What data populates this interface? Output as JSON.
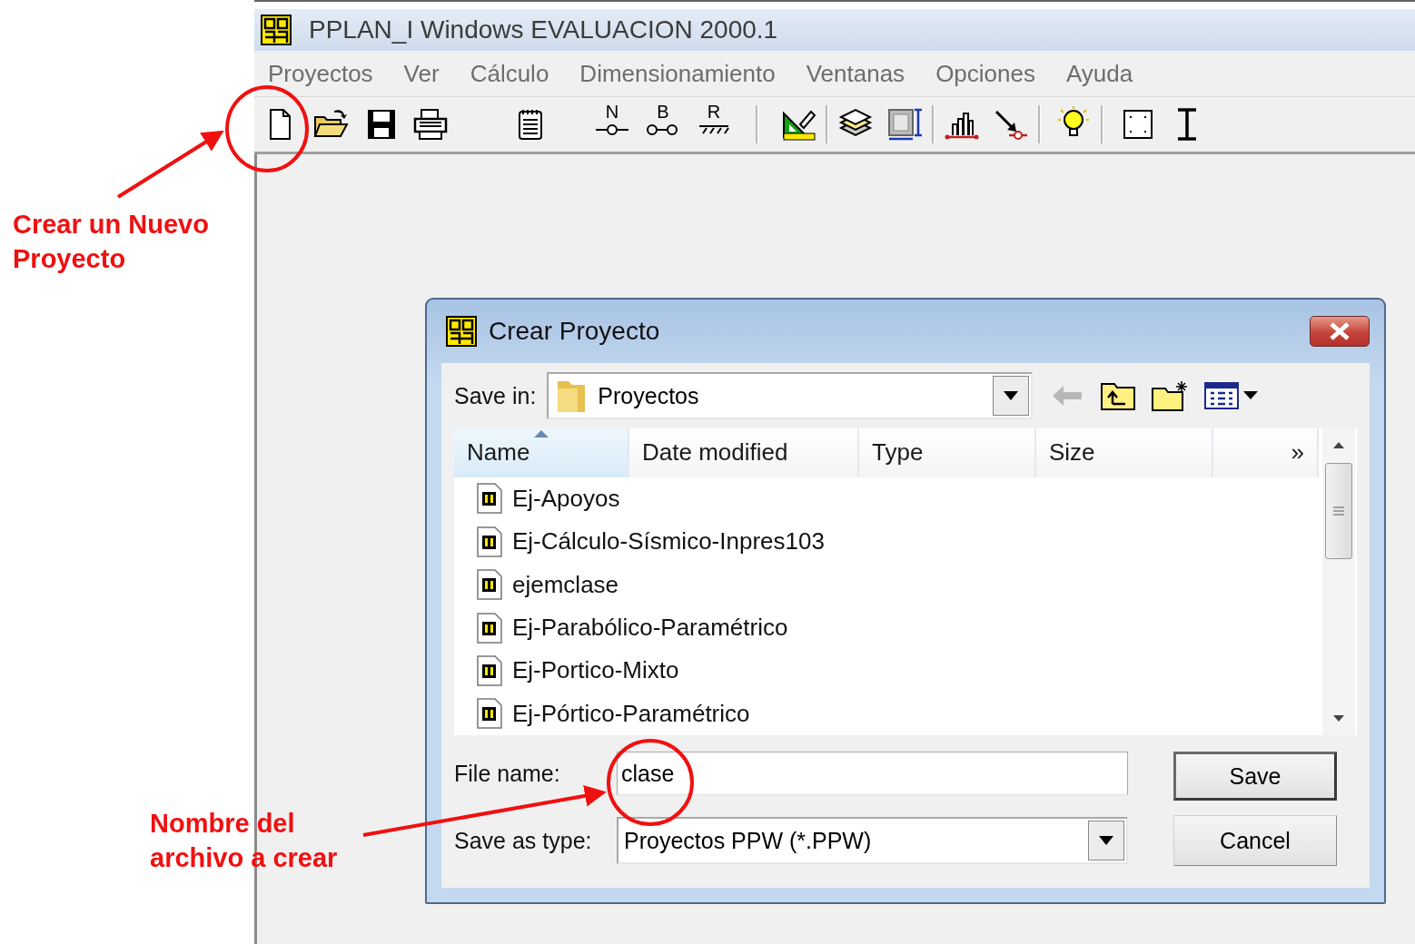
{
  "window": {
    "title": "PPLAN_I Windows EVALUACION 2000.1"
  },
  "menu": [
    {
      "label": "Proyectos"
    },
    {
      "label": "Ver"
    },
    {
      "label": "Cálculo"
    },
    {
      "label": "Dimensionamiento"
    },
    {
      "label": "Ventanas"
    },
    {
      "label": "Opciones"
    },
    {
      "label": "Ayuda"
    }
  ],
  "toolbar": {
    "letter_buttons": [
      {
        "letter": "N"
      },
      {
        "letter": "B"
      },
      {
        "letter": "R"
      }
    ]
  },
  "dialog": {
    "title": "Crear Proyecto",
    "save_in": {
      "label": "Save in:",
      "value": "Proyectos"
    },
    "columns": [
      {
        "label": "Name",
        "kind": "column",
        "sorted": true
      },
      {
        "label": "Date modified",
        "kind": "column",
        "sorted": false
      },
      {
        "label": "Type",
        "kind": "column",
        "sorted": false
      },
      {
        "label": "Size",
        "kind": "column",
        "sorted": false
      },
      {
        "label": "»",
        "kind": "overflow",
        "sorted": false
      }
    ],
    "files": [
      {
        "name": "Ej-Apoyos"
      },
      {
        "name": "Ej-Cálculo-Sísmico-Inpres103"
      },
      {
        "name": "ejemclase"
      },
      {
        "name": "Ej-Parabólico-Paramétrico"
      },
      {
        "name": "Ej-Portico-Mixto"
      },
      {
        "name": "Ej-Pórtico-Paramétrico"
      }
    ],
    "file_name": {
      "label": "File name:",
      "value": "clase"
    },
    "save_as_type": {
      "label": "Save as type:",
      "value": "Proyectos PPW (*.PPW)"
    },
    "buttons": [
      {
        "label": "Save",
        "default": true
      },
      {
        "label": "Cancel",
        "default": false
      }
    ]
  },
  "annotations": [
    {
      "text": "Crear un Nuevo Proyecto"
    },
    {
      "text": "Nombre del archivo a crear"
    }
  ]
}
